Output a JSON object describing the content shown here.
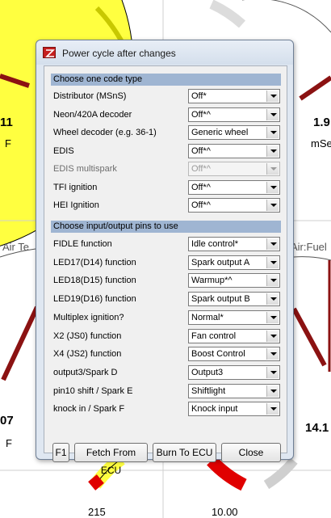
{
  "window": {
    "title": "Power cycle after changes"
  },
  "sections": {
    "code_type": "Choose one code type",
    "pins": "Choose input/output pins to use"
  },
  "code_rows": [
    {
      "label": "Distributor (MSnS)",
      "value": "Off*",
      "enabled": true
    },
    {
      "label": "Neon/420A decoder",
      "value": "Off*^",
      "enabled": true
    },
    {
      "label": "Wheel decoder (e.g. 36-1)",
      "value": "Generic wheel",
      "enabled": true
    },
    {
      "label": "EDIS",
      "value": "Off*^",
      "enabled": true
    },
    {
      "label": "EDIS multispark",
      "value": "Off*^",
      "enabled": false
    },
    {
      "label": "TFI ignition",
      "value": "Off*^",
      "enabled": true
    },
    {
      "label": "HEI Ignition",
      "value": "Off*^",
      "enabled": true
    }
  ],
  "pin_rows": [
    {
      "label": "FIDLE function",
      "value": "Idle control*"
    },
    {
      "label": "LED17(D14) function",
      "value": "Spark output A"
    },
    {
      "label": "LED18(D15) function",
      "value": "Warmup*^"
    },
    {
      "label": "LED19(D16) function",
      "value": "Spark output B"
    },
    {
      "label": "Multiplex ignition?",
      "value": "Normal*"
    },
    {
      "label": "X2 (JS0) function",
      "value": "Fan control"
    },
    {
      "label": "X4 (JS2) function",
      "value": "Boost Control"
    },
    {
      "label": "output3/Spark D",
      "value": "Output3"
    },
    {
      "label": "pin10 shift / Spark E",
      "value": "Shiftlight"
    },
    {
      "label": "knock in / Spark F",
      "value": "Knock input"
    }
  ],
  "buttons": {
    "f1": "F1",
    "fetch": "Fetch From ECU",
    "burn": "Burn To ECU",
    "close": "Close"
  },
  "background": {
    "tl_value": "11",
    "tl_unit": "F",
    "tr_value": "1.9",
    "tr_unit": "mSe",
    "ml_title": "Air Te",
    "mr_title": "Air:Fuel",
    "bl_value": "07",
    "bl_unit": "F",
    "br_value": "14.1",
    "bottom_left_value": "215",
    "bottom_right_value": "10.00"
  },
  "colors": {
    "gauge_yellow": "#ffff40",
    "needle": "#8b1212",
    "danger_red": "#e00000",
    "section_bar": "#9fb5d2"
  }
}
